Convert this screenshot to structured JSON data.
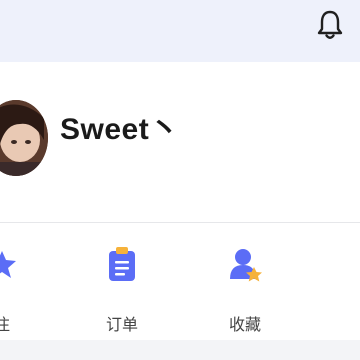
{
  "header": {
    "bell_icon": "bell-icon"
  },
  "profile": {
    "username": "Sweet丶",
    "avatar_icon": "avatar"
  },
  "shortcuts": [
    {
      "label": "注",
      "icon": "star-icon"
    },
    {
      "label": "订单",
      "icon": "clipboard-icon"
    },
    {
      "label": "收藏",
      "icon": "user-star-icon"
    },
    {
      "label": "",
      "icon": "more-icon"
    }
  ],
  "colors": {
    "accent_blue": "#5b6df6",
    "accent_orange": "#f6b23a",
    "topbar_bg": "#eef1fb"
  }
}
